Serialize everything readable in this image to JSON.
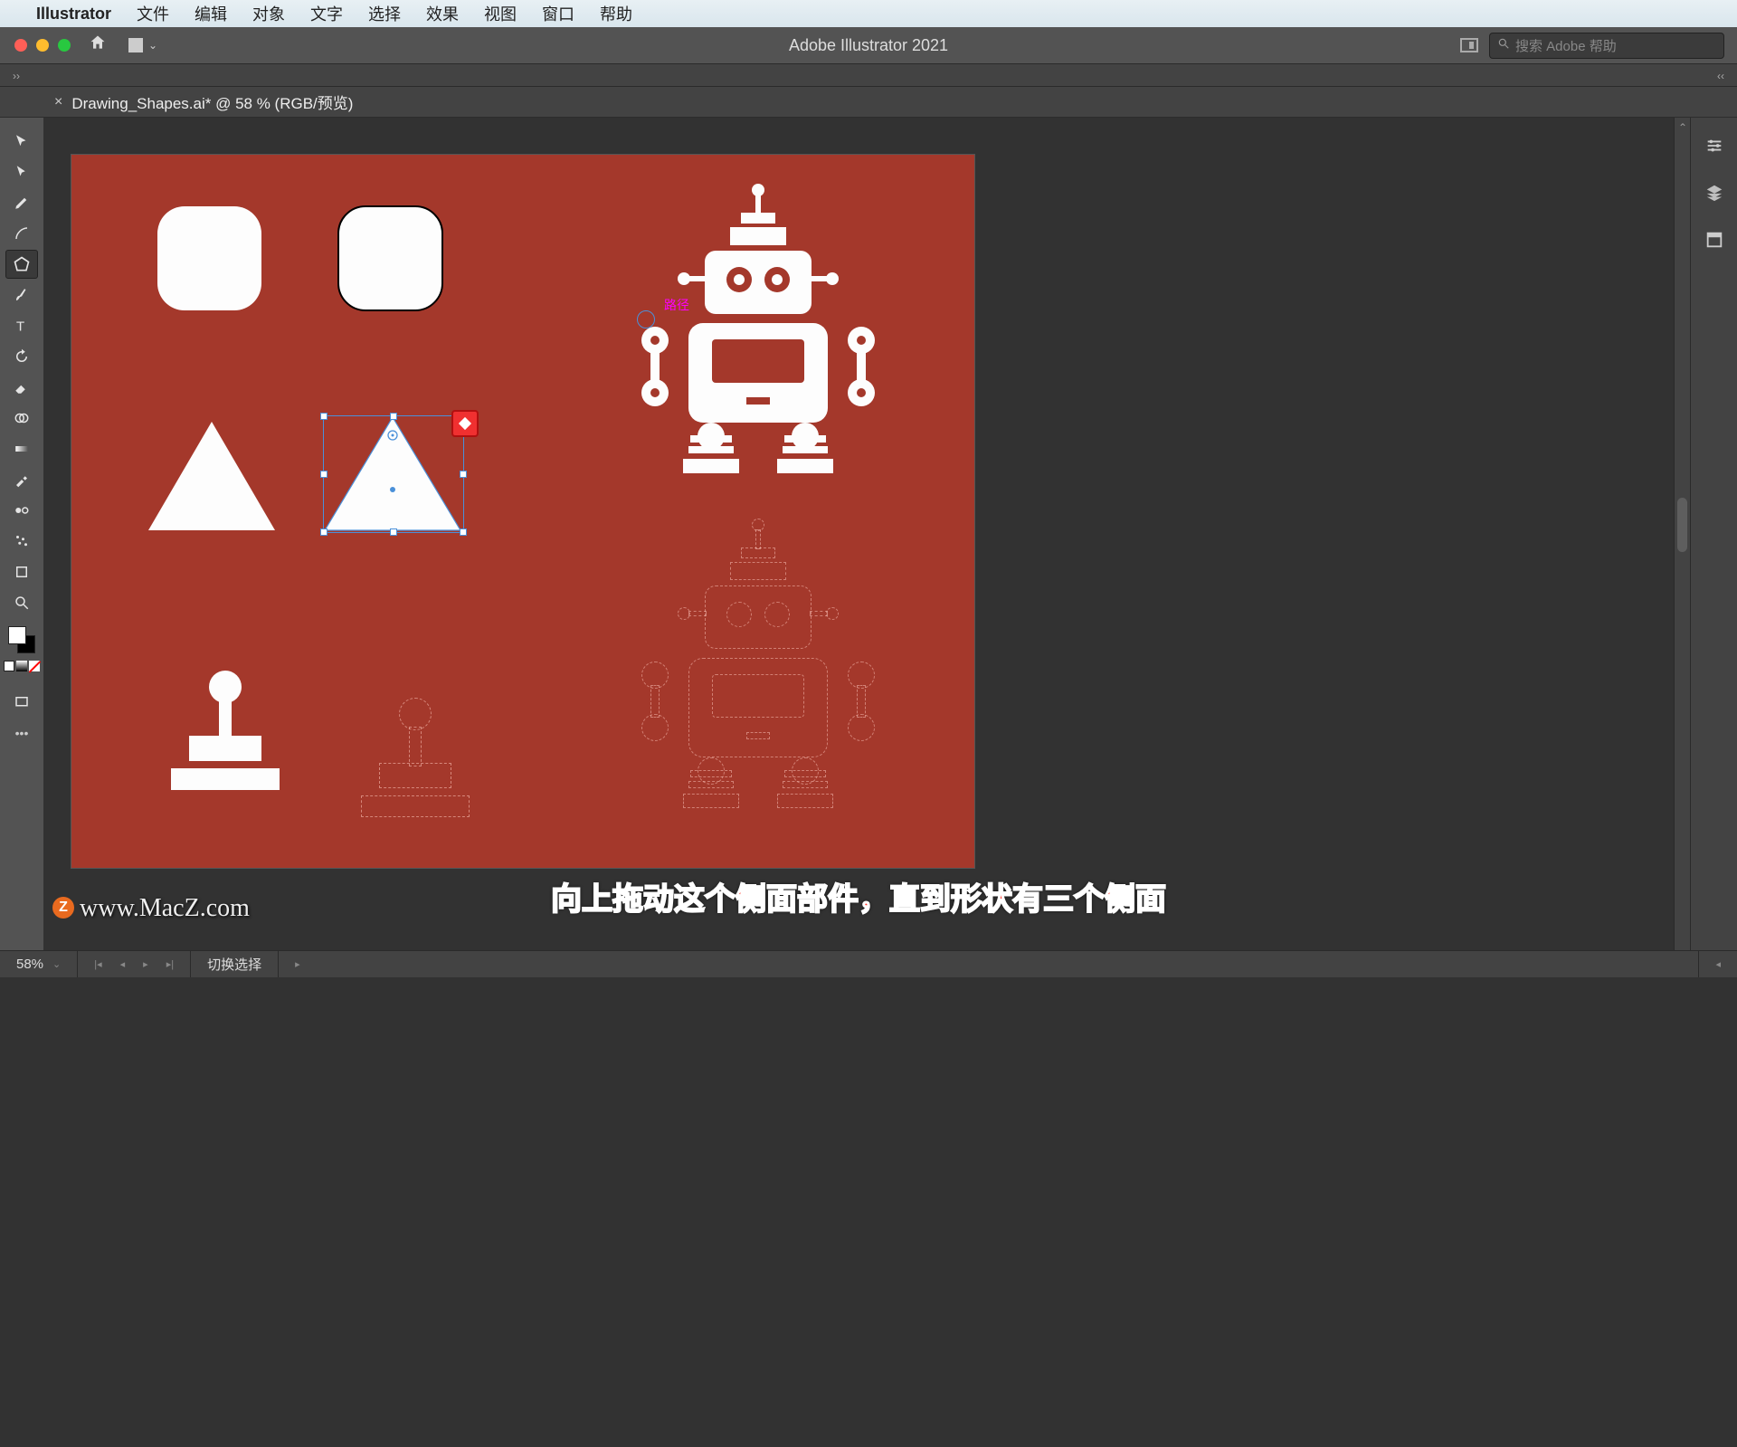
{
  "menubar": {
    "app_name": "Illustrator",
    "items": [
      "文件",
      "编辑",
      "对象",
      "文字",
      "选择",
      "效果",
      "视图",
      "窗口",
      "帮助"
    ]
  },
  "title": "Adobe Illustrator 2021",
  "search": {
    "placeholder": "搜索 Adobe 帮助"
  },
  "document": {
    "tab_label": "Drawing_Shapes.ai* @ 58 % (RGB/预览)"
  },
  "annotation": {
    "label": "路径"
  },
  "status": {
    "zoom": "58%",
    "mode": "切换选择"
  },
  "caption": "向上拖动这个侧面部件，直到形状有三个侧面",
  "watermark": "www.MacZ.com",
  "watermark_badge": "Z",
  "panel_icons": [
    "properties-icon",
    "layers-icon",
    "libraries-icon"
  ],
  "tools": [
    "selection-tool",
    "direct-selection-tool",
    "pen-tool",
    "curvature-tool",
    "polygon-tool",
    "brush-tool",
    "type-tool",
    "rotate-tool",
    "eraser-tool",
    "shape-builder-tool",
    "gradient-tool",
    "eyedropper-tool",
    "blend-tool",
    "symbol-sprayer-tool",
    "artboard-tool",
    "zoom-tool"
  ],
  "active_tool_index": 4
}
